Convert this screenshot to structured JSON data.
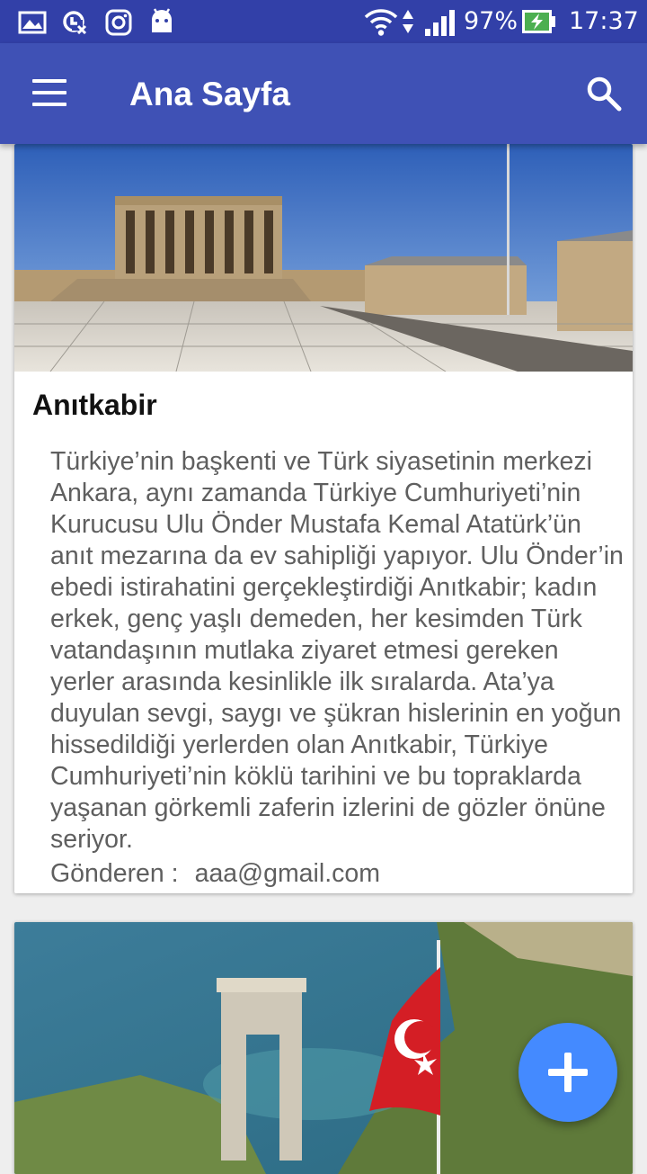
{
  "status_bar": {
    "battery_percent": "97%",
    "time": "17:37",
    "icons": [
      "gallery-icon",
      "sync-icon",
      "instagram-icon",
      "android-icon",
      "wifi-icon",
      "signal-icon",
      "battery-charging-icon"
    ]
  },
  "app_bar": {
    "title": "Ana Sayfa",
    "menu_icon": "hamburger-menu-icon",
    "search_icon": "search-icon",
    "color": "#3f51b5"
  },
  "posts": [
    {
      "title": "Anıtkabir",
      "description": "Türkiye’nin başkenti ve Türk siyasetinin merkezi Ankara, aynı zamanda Türkiye Cumhuriyeti’nin Kurucusu Ulu Önder Mustafa Kemal Atatürk’ün anıt mezarına da ev sahipliği yapıyor. Ulu Önder’in ebedi istirahatini gerçekleştirdiği Anıtkabir; kadın erkek, genç yaşlı demeden, her kesimden Türk vatandaşının mutlaka ziyaret etmesi gereken yerler arasında kesinlikle ilk sıralarda. Ata’ya duyulan sevgi, saygı ve şükran hislerinin en yoğun hissedildiği yerlerden olan Anıtkabir, Türkiye Cumhuriyeti’nin köklü tarihini ve bu topraklarda yaşanan görkemli zaferin izlerini de gözler önüne seriyor.",
      "sender_label": "Gönderen :",
      "sender_email": "aaa@gmail.com"
    },
    {
      "title": "",
      "description": "",
      "sender_label": "",
      "sender_email": ""
    }
  ],
  "fab": {
    "icon": "plus-icon",
    "color": "#448aff"
  }
}
